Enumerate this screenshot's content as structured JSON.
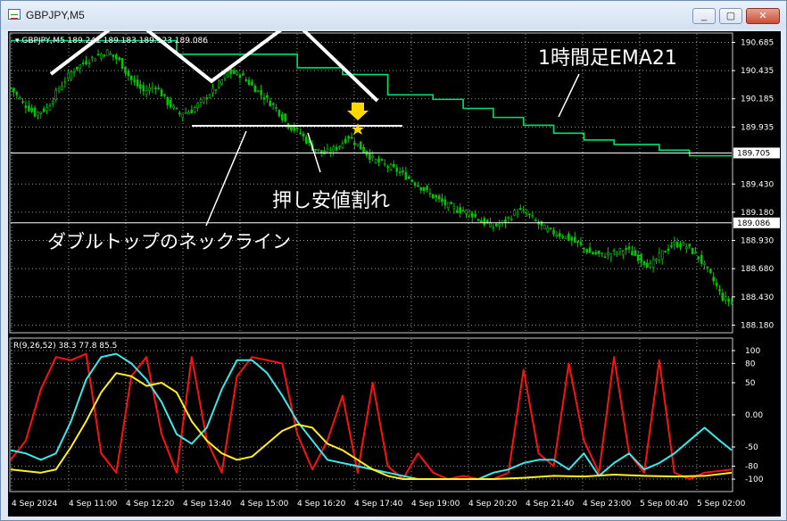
{
  "window": {
    "title": "GBPJPY,M5",
    "buttons": [
      "_",
      "▢",
      "✕"
    ]
  },
  "chart_data": [
    {
      "type": "line",
      "title": "GBPJPY,M5",
      "header_text": "▾ GBPJPY,M5 189.241 189.183 189.123 189.086",
      "series": [
        {
          "name": "",
          "style": "candlestick",
          "color": "#00c800"
        },
        {
          "name": "",
          "color": "#00e070"
        }
      ],
      "price_ticks": [
        "190.685",
        "190.435",
        "190.185",
        "189.935",
        "189.430",
        "189.180",
        "188.930",
        "188.680",
        "188.430",
        "188.180"
      ],
      "ylim": [
        188.18,
        190.685
      ],
      "horizontal_lines": [
        {
          "value": 189.705,
          "label": "189.705"
        },
        {
          "value": 189.086,
          "label": "189.086"
        }
      ],
      "close_path": [
        [
          0,
          190.28
        ],
        [
          4,
          190.15
        ],
        [
          8,
          190.05
        ],
        [
          12,
          190.1
        ],
        [
          16,
          190.28
        ],
        [
          20,
          190.42
        ],
        [
          24,
          190.5
        ],
        [
          28,
          190.56
        ],
        [
          32,
          190.6
        ],
        [
          36,
          190.52
        ],
        [
          40,
          190.35
        ],
        [
          44,
          190.25
        ],
        [
          48,
          190.3
        ],
        [
          52,
          190.15
        ],
        [
          56,
          190.05
        ],
        [
          60,
          190.08
        ],
        [
          64,
          190.18
        ],
        [
          68,
          190.28
        ],
        [
          72,
          190.42
        ],
        [
          76,
          190.4
        ],
        [
          80,
          190.3
        ],
        [
          84,
          190.2
        ],
        [
          88,
          190.1
        ],
        [
          92,
          189.95
        ],
        [
          96,
          189.88
        ],
        [
          100,
          189.75
        ],
        [
          104,
          189.7
        ],
        [
          108,
          189.75
        ],
        [
          112,
          189.85
        ],
        [
          116,
          189.75
        ],
        [
          120,
          189.65
        ],
        [
          124,
          189.6
        ],
        [
          128,
          189.55
        ],
        [
          132,
          189.48
        ],
        [
          136,
          189.4
        ],
        [
          140,
          189.32
        ],
        [
          144,
          189.25
        ],
        [
          148,
          189.2
        ],
        [
          152,
          189.18
        ],
        [
          156,
          189.1
        ],
        [
          160,
          189.05
        ],
        [
          164,
          189.1
        ],
        [
          168,
          189.2
        ],
        [
          172,
          189.15
        ],
        [
          176,
          189.05
        ],
        [
          180,
          189.0
        ],
        [
          184,
          188.96
        ],
        [
          188,
          188.9
        ],
        [
          192,
          188.82
        ],
        [
          196,
          188.8
        ],
        [
          200,
          188.82
        ],
        [
          204,
          188.85
        ],
        [
          208,
          188.78
        ],
        [
          212,
          188.7
        ],
        [
          216,
          188.82
        ],
        [
          220,
          188.9
        ],
        [
          224,
          188.88
        ],
        [
          228,
          188.78
        ],
        [
          232,
          188.62
        ],
        [
          236,
          188.42
        ],
        [
          239,
          188.38
        ]
      ],
      "ema21": [
        [
          0,
          190.7
        ],
        [
          30,
          190.7
        ],
        [
          55,
          190.58
        ],
        [
          80,
          190.58
        ],
        [
          95,
          190.46
        ],
        [
          110,
          190.4
        ],
        [
          125,
          190.22
        ],
        [
          140,
          190.18
        ],
        [
          150,
          190.1
        ],
        [
          160,
          190.02
        ],
        [
          170,
          189.95
        ],
        [
          180,
          189.88
        ],
        [
          190,
          189.82
        ],
        [
          200,
          189.78
        ],
        [
          215,
          189.73
        ],
        [
          225,
          189.68
        ],
        [
          239,
          189.68
        ]
      ],
      "annotations": {
        "double_top_neckline": "ダブルトップのネックライン",
        "break_label": "押し安値割れ",
        "ema_label": "1時間足EMA21"
      }
    },
    {
      "type": "line",
      "title": "",
      "header_text": "R(9,26,52) 38.3 77.8 85.5",
      "y_ticks": [
        "100",
        "80",
        "50",
        "0.00",
        "-50",
        "-80",
        "-100"
      ],
      "ylim": [
        -100,
        100
      ],
      "x_ticks": [
        "4 Sep 2024",
        "4 Sep 11:00",
        "4 Sep 12:20",
        "4 Sep 13:40",
        "4 Sep 15:00",
        "4 Sep 16:20",
        "4 Sep 17:40",
        "4 Sep 19:00",
        "4 Sep 20:20",
        "4 Sep 21:40",
        "4 Sep 23:00",
        "5 Sep 00:40",
        "5 Sep 02:00"
      ],
      "series": [
        {
          "name": "",
          "color": "#ff1010",
          "values": [
            [
              0,
              -70
            ],
            [
              5,
              -40
            ],
            [
              10,
              40
            ],
            [
              15,
              90
            ],
            [
              20,
              85
            ],
            [
              25,
              95
            ],
            [
              30,
              -60
            ],
            [
              35,
              -90
            ],
            [
              40,
              60
            ],
            [
              45,
              90
            ],
            [
              50,
              -30
            ],
            [
              55,
              -90
            ],
            [
              60,
              90
            ],
            [
              65,
              -40
            ],
            [
              70,
              -90
            ],
            [
              75,
              60
            ],
            [
              80,
              90
            ],
            [
              85,
              85
            ],
            [
              90,
              80
            ],
            [
              95,
              -30
            ],
            [
              100,
              -85
            ],
            [
              105,
              -40
            ],
            [
              110,
              30
            ],
            [
              115,
              -90
            ],
            [
              120,
              50
            ],
            [
              125,
              -80
            ],
            [
              130,
              -100
            ],
            [
              135,
              -60
            ],
            [
              140,
              -90
            ],
            [
              145,
              -100
            ],
            [
              150,
              -95
            ],
            [
              155,
              -100
            ],
            [
              160,
              -100
            ],
            [
              165,
              -90
            ],
            [
              170,
              70
            ],
            [
              175,
              -60
            ],
            [
              180,
              -80
            ],
            [
              185,
              80
            ],
            [
              190,
              -40
            ],
            [
              195,
              -90
            ],
            [
              200,
              90
            ],
            [
              205,
              -60
            ],
            [
              210,
              -90
            ],
            [
              215,
              85
            ],
            [
              220,
              -90
            ],
            [
              225,
              -100
            ],
            [
              230,
              -90
            ],
            [
              239,
              -85
            ]
          ]
        },
        {
          "name": "",
          "color": "#3ee8e8",
          "values": [
            [
              0,
              -55
            ],
            [
              5,
              -60
            ],
            [
              10,
              -70
            ],
            [
              15,
              -60
            ],
            [
              20,
              -10
            ],
            [
              25,
              55
            ],
            [
              30,
              90
            ],
            [
              35,
              95
            ],
            [
              40,
              80
            ],
            [
              45,
              55
            ],
            [
              50,
              20
            ],
            [
              55,
              -30
            ],
            [
              60,
              -45
            ],
            [
              65,
              -20
            ],
            [
              70,
              40
            ],
            [
              75,
              85
            ],
            [
              80,
              85
            ],
            [
              85,
              65
            ],
            [
              90,
              30
            ],
            [
              95,
              -10
            ],
            [
              100,
              -40
            ],
            [
              105,
              -70
            ],
            [
              110,
              -75
            ],
            [
              115,
              -80
            ],
            [
              120,
              -85
            ],
            [
              125,
              -90
            ],
            [
              130,
              -95
            ],
            [
              135,
              -100
            ],
            [
              140,
              -100
            ],
            [
              145,
              -100
            ],
            [
              150,
              -100
            ],
            [
              155,
              -100
            ],
            [
              160,
              -90
            ],
            [
              165,
              -85
            ],
            [
              170,
              -75
            ],
            [
              175,
              -70
            ],
            [
              180,
              -70
            ],
            [
              185,
              -85
            ],
            [
              190,
              -60
            ],
            [
              195,
              -95
            ],
            [
              200,
              -75
            ],
            [
              205,
              -60
            ],
            [
              210,
              -85
            ],
            [
              215,
              -75
            ],
            [
              220,
              -60
            ],
            [
              225,
              -40
            ],
            [
              230,
              -20
            ],
            [
              235,
              -40
            ],
            [
              239,
              -55
            ]
          ]
        },
        {
          "name": "",
          "color": "#ffee22",
          "values": [
            [
              0,
              -85
            ],
            [
              10,
              -90
            ],
            [
              15,
              -85
            ],
            [
              20,
              -50
            ],
            [
              25,
              -10
            ],
            [
              30,
              35
            ],
            [
              35,
              65
            ],
            [
              40,
              60
            ],
            [
              45,
              45
            ],
            [
              50,
              50
            ],
            [
              55,
              35
            ],
            [
              60,
              -10
            ],
            [
              65,
              -40
            ],
            [
              70,
              -60
            ],
            [
              75,
              -70
            ],
            [
              80,
              -65
            ],
            [
              85,
              -45
            ],
            [
              90,
              -25
            ],
            [
              95,
              -15
            ],
            [
              100,
              -20
            ],
            [
              105,
              -45
            ],
            [
              110,
              -55
            ],
            [
              115,
              -70
            ],
            [
              120,
              -85
            ],
            [
              125,
              -95
            ],
            [
              130,
              -100
            ],
            [
              140,
              -100
            ],
            [
              150,
              -100
            ],
            [
              160,
              -100
            ],
            [
              170,
              -98
            ],
            [
              180,
              -95
            ],
            [
              190,
              -96
            ],
            [
              200,
              -93
            ],
            [
              210,
              -95
            ],
            [
              220,
              -96
            ],
            [
              230,
              -95
            ],
            [
              239,
              -90
            ]
          ]
        }
      ]
    }
  ]
}
